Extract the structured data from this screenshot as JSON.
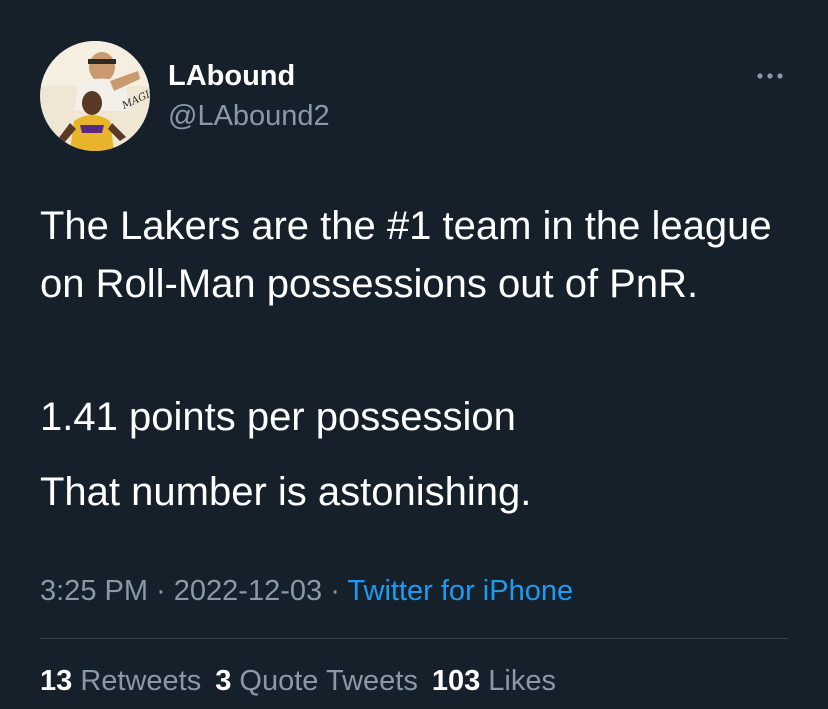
{
  "user": {
    "display_name": "LAbound",
    "handle": "@LAbound2",
    "avatar_logo_text": "MAGIC"
  },
  "tweet": {
    "paragraphs": [
      "The Lakers are the #1 team in the league on Roll-Man possessions out of PnR.",
      "1.41 points per possession",
      "That number is astonishing."
    ],
    "time": "3:25 PM",
    "date": "2022-12-03",
    "separator": "·",
    "source": "Twitter for iPhone"
  },
  "stats": {
    "retweets_count": "13",
    "retweets_label": "Retweets",
    "quotes_count": "3",
    "quotes_label": "Quote Tweets",
    "likes_count": "103",
    "likes_label": "Likes"
  },
  "icons": {
    "more": "more-horizontal-icon"
  },
  "colors": {
    "background": "#15202b",
    "primary_text": "#ffffff",
    "secondary_text": "#8b98a5",
    "accent": "#1d9bf0",
    "divider": "#38444d"
  }
}
